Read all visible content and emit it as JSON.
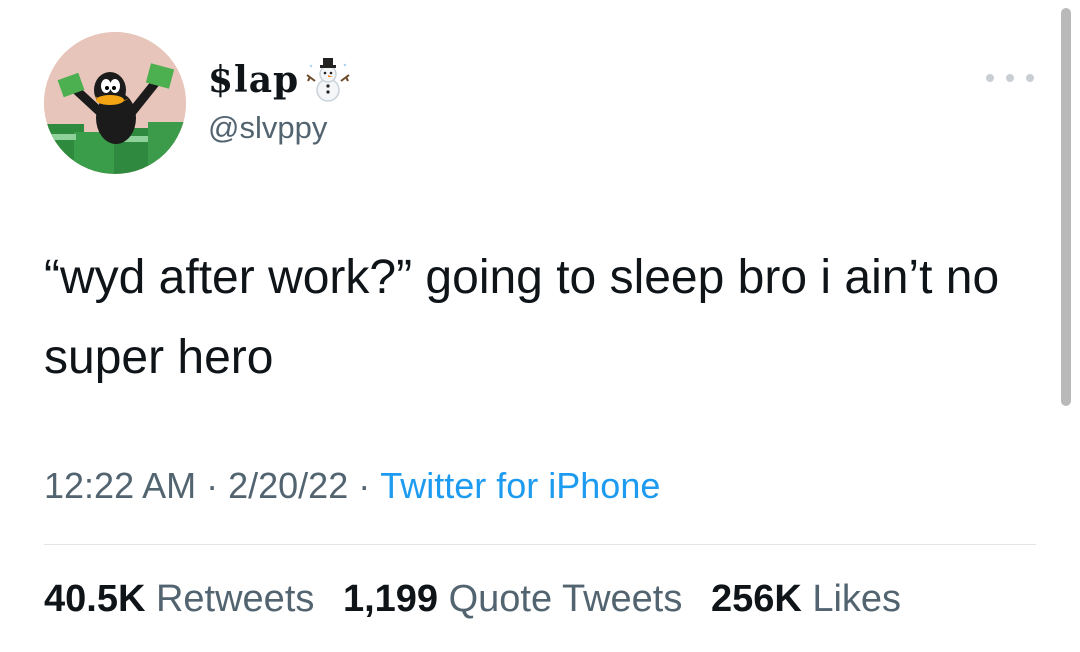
{
  "author": {
    "display_name": "$lap",
    "emoji_icon": "snowman-icon",
    "handle": "@slvppy",
    "avatar_icon": "daffy-duck-with-cash-avatar"
  },
  "tweet": {
    "text": "“wyd after work?” going to sleep bro i ain’t no super hero"
  },
  "meta": {
    "time": "12:22 AM",
    "separator": "·",
    "date": "2/20/22",
    "source": "Twitter for iPhone"
  },
  "stats": {
    "retweets_count": "40.5K",
    "retweets_label": "Retweets",
    "quotes_count": "1,199",
    "quotes_label": "Quote Tweets",
    "likes_count": "256K",
    "likes_label": "Likes"
  },
  "colors": {
    "text": "#0f1419",
    "secondary": "#536471",
    "link": "#1d9bf0"
  }
}
